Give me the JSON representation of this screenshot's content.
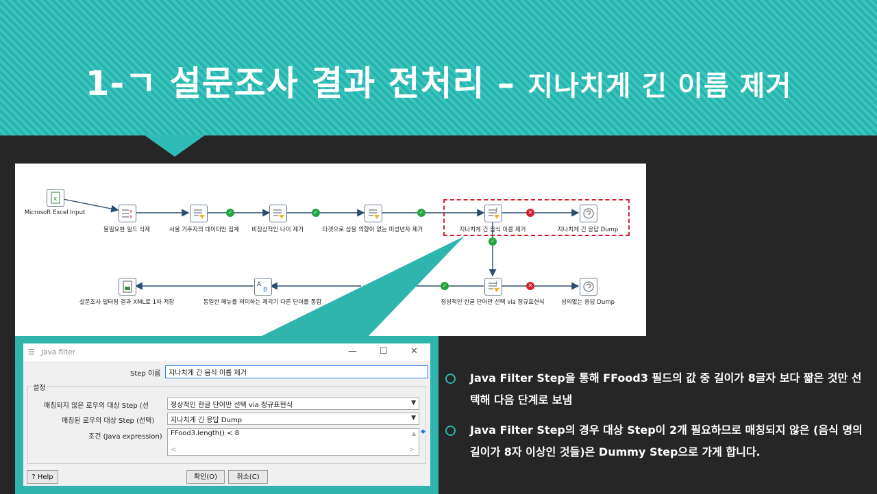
{
  "slide": {
    "title_main": "1-ㄱ 설문조사 결과 전처리 – ",
    "title_sub": "지나치게 긴 이름 제거"
  },
  "workflow": {
    "nodes": [
      {
        "id": "excel",
        "label": "Microsoft Excel Input",
        "icon": "excel-icon"
      },
      {
        "id": "remove-fields",
        "label": "불필요한 필드 삭제",
        "icon": "select-values-icon"
      },
      {
        "id": "seoul",
        "label": "서울 거주자의 데이터만 집계",
        "icon": "filter-icon"
      },
      {
        "id": "age",
        "label": "비정상적인 나이 제거",
        "icon": "filter-icon"
      },
      {
        "id": "minor",
        "label": "타겟으로 삼을 의향이 없는 미성년자 제거",
        "icon": "filter-icon"
      },
      {
        "id": "long-name",
        "label": "지나치게 긴 음식 이름 제거",
        "icon": "java-filter-icon"
      },
      {
        "id": "long-dump",
        "label": "지나치게 긴 응답 Dump",
        "icon": "dummy-icon"
      },
      {
        "id": "regex",
        "label": "정상적인 한글 단어만 선택 via 정규표현식",
        "icon": "java-filter-icon"
      },
      {
        "id": "meaningless-dump",
        "label": "성의없는 응답 Dump",
        "icon": "dummy-icon"
      },
      {
        "id": "merge",
        "label": "동일한 메뉴를 의미하는 제각기 다른 단어를 통합",
        "icon": "value-mapper-icon"
      },
      {
        "id": "xml",
        "label": "설문조사 필터링 결과 XML로 1차 저장",
        "icon": "xml-output-icon"
      }
    ]
  },
  "dialog": {
    "title": "Java filter",
    "step_name_label": "Step 이름",
    "step_name_value": "지나치게 긴 음식 이름 제거",
    "group_label": "설정",
    "unmatched_label": "매칭되지 않은 로우의 대상 Step (선",
    "unmatched_value": "정상적인 한글 단어만 선택 via 정규표현식",
    "matched_label": "매칭된 로우의 대상 Step (선택)",
    "matched_value": "지나치게 긴 응답 Dump",
    "condition_label": "조건 (Java expression)",
    "condition_value": "FFood3.length() < 8",
    "help_label": "Help",
    "ok_label": "확인(O)",
    "cancel_label": "취소(C)"
  },
  "bullets": [
    "Java Filter Step을 통해 FFood3 필드의 값 중 길이가 8글자 보다 짧은 것만 선택해 다음 단계로 보냄",
    "Java Filter Step의 경우 대상 Step이 2개 필요하므로 매칭되지 않은 (음식 명의 길이가 8자 이상인 것들)은 Dummy Step으로 가게 합니다."
  ],
  "colors": {
    "accent": "#2fb5ae",
    "background": "#262626",
    "ok": "#22a33b",
    "error": "#d61f2b"
  }
}
